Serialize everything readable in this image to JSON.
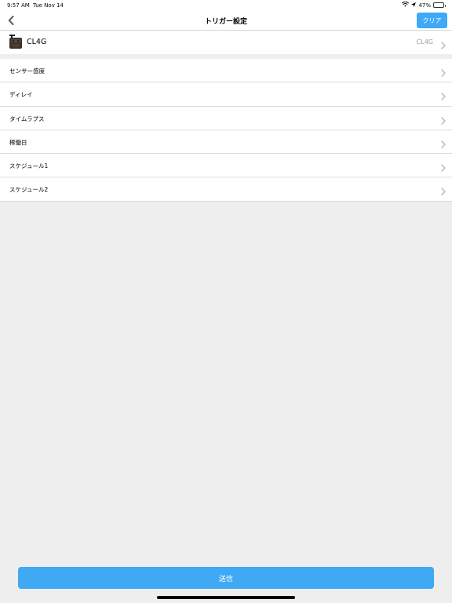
{
  "status_bar": {
    "time": "9:57 AM",
    "date": "Tue Nov 14",
    "battery": "47%",
    "battery_level": 0.47,
    "icons": [
      "wifi-icon",
      "location-icon",
      "battery-icon"
    ]
  },
  "nav": {
    "title": "トリガー設定",
    "clear_label": "クリア",
    "back_icon": "chevron-left-icon"
  },
  "device": {
    "name": "CL4G",
    "value": "CL4G",
    "icon": "camera-device-icon"
  },
  "menu": {
    "items": [
      {
        "label": "センサー感度"
      },
      {
        "label": "ディレイ"
      },
      {
        "label": "タイムラプス"
      },
      {
        "label": "稼働日"
      },
      {
        "label": "スケジュール1"
      },
      {
        "label": "スケジュール2"
      }
    ]
  },
  "footer": {
    "send_label": "送信"
  },
  "colors": {
    "accent": "#3fa9f5",
    "background": "#eeeeee",
    "battery_fill": "#35c759"
  }
}
